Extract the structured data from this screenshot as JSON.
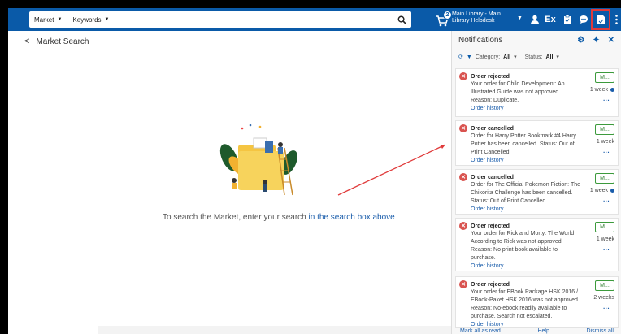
{
  "header": {
    "market_label": "Market",
    "keywords_label": "Keywords",
    "search_value": "",
    "cart_count": "2",
    "library_line1": "Main Library - Main",
    "library_line2": "Library Helpdesk",
    "ex_label": "Ex"
  },
  "main": {
    "title": "Market Search",
    "prompt_text": "To search the Market, enter your search ",
    "prompt_link": "in the search box above"
  },
  "notifications": {
    "title": "Notifications",
    "category_label": "Category:",
    "category_value": "All",
    "status_label": "Status:",
    "status_value": "All",
    "items": [
      {
        "heading": "Order rejected",
        "body": "Your order for Child Development: An Illustrated Guide was not approved. Reason: Duplicate.",
        "link": "Order history",
        "button": "M...",
        "time": "1 week",
        "unread": true
      },
      {
        "heading": "Order cancelled",
        "body": "Order for Harry Potter Bookmark #4 Harry Potter has been cancelled. Status: Out of Print Cancelled.",
        "link": "Order history",
        "button": "M...",
        "time": "1 week",
        "unread": false
      },
      {
        "heading": "Order cancelled",
        "body": "Order for The Official Pokemon Fiction: The Chikorita Challenge has been cancelled. Status: Out of Print Cancelled.",
        "link": "Order history",
        "button": "M...",
        "time": "1 week",
        "unread": true
      },
      {
        "heading": "Order rejected",
        "body": "Your order for Rick and Morty: The World According to Rick was not approved. Reason: No print book available to purchase.",
        "link": "Order history",
        "button": "M...",
        "time": "1 week",
        "unread": false
      },
      {
        "heading": "Order rejected",
        "body": "Your order for EBook Package HSK 2016 / EBook-Paket HSK 2016 was not approved. Reason: No-ebook readily available to purchase. Search not escalated.",
        "link": "Order history",
        "button": "M...",
        "time": "2 weeks",
        "unread": false
      }
    ],
    "footer_mark": "Mark all as read",
    "footer_help": "Help",
    "footer_dismiss": "Dismiss all"
  },
  "colors": {
    "header_bg": "#0a5aa8",
    "error_red": "#d9534f",
    "button_green": "#3c9a3c",
    "link_blue": "#1a5dab",
    "annotation_red": "#e03a3a"
  }
}
